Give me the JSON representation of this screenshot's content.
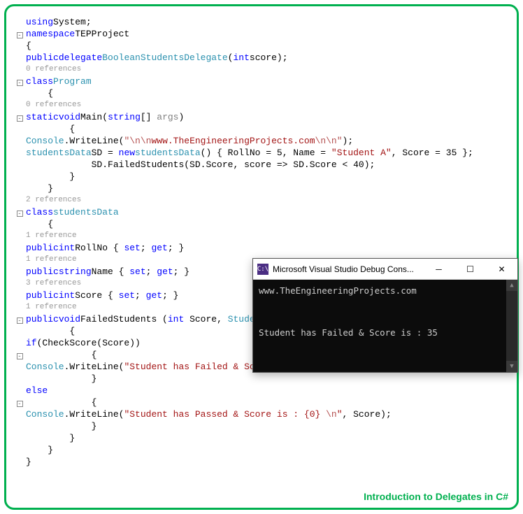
{
  "code": {
    "using": "using",
    "system": "System",
    "namespace_kw": "namespace",
    "namespace_name": "TEPProject",
    "public": "public",
    "delegate_kw": "delegate",
    "boolean": "Boolean",
    "delegate_name": "StudentsDelegate",
    "int": "int",
    "score_param": "score",
    "refs0": "0 references",
    "refs1": "1 reference",
    "refs2": "2 references",
    "refs3": "3 references",
    "class_kw": "class",
    "program": "Program",
    "static": "static",
    "void": "void",
    "main": "Main",
    "string": "string",
    "args": "args",
    "console": "Console",
    "writeline": "WriteLine",
    "str_nl1": "\"\\n\\n",
    "str_url": "www.TheEngineeringProjects.com",
    "str_nl2": "\\n\\n\"",
    "studentsData": "studentsData",
    "sd": "SD",
    "new_kw": "new",
    "rollno_prop": "RollNo",
    "rollno_val": "5",
    "name_prop": "Name",
    "name_val": "\"Student A\"",
    "score_prop": "Score",
    "score_val": "35",
    "failedstudents": "FailedStudents",
    "lambda": "score => SD.Score < 40",
    "set": "set",
    "get": "get",
    "checkscore": "CheckScore",
    "if_kw": "if",
    "else_kw": "else",
    "str_failed": "\"Student has Failed & Score is : {0} \\n\"",
    "str_passed": "\"Student has Passed & Score is : {0} \\n\""
  },
  "console": {
    "title": "Microsoft Visual Studio Debug Cons...",
    "icon_text": "C:\\",
    "line1": "www.TheEngineeringProjects.com",
    "line2": "Student has Failed & Score is : 35"
  },
  "caption": "Introduction to Delegates in C#"
}
